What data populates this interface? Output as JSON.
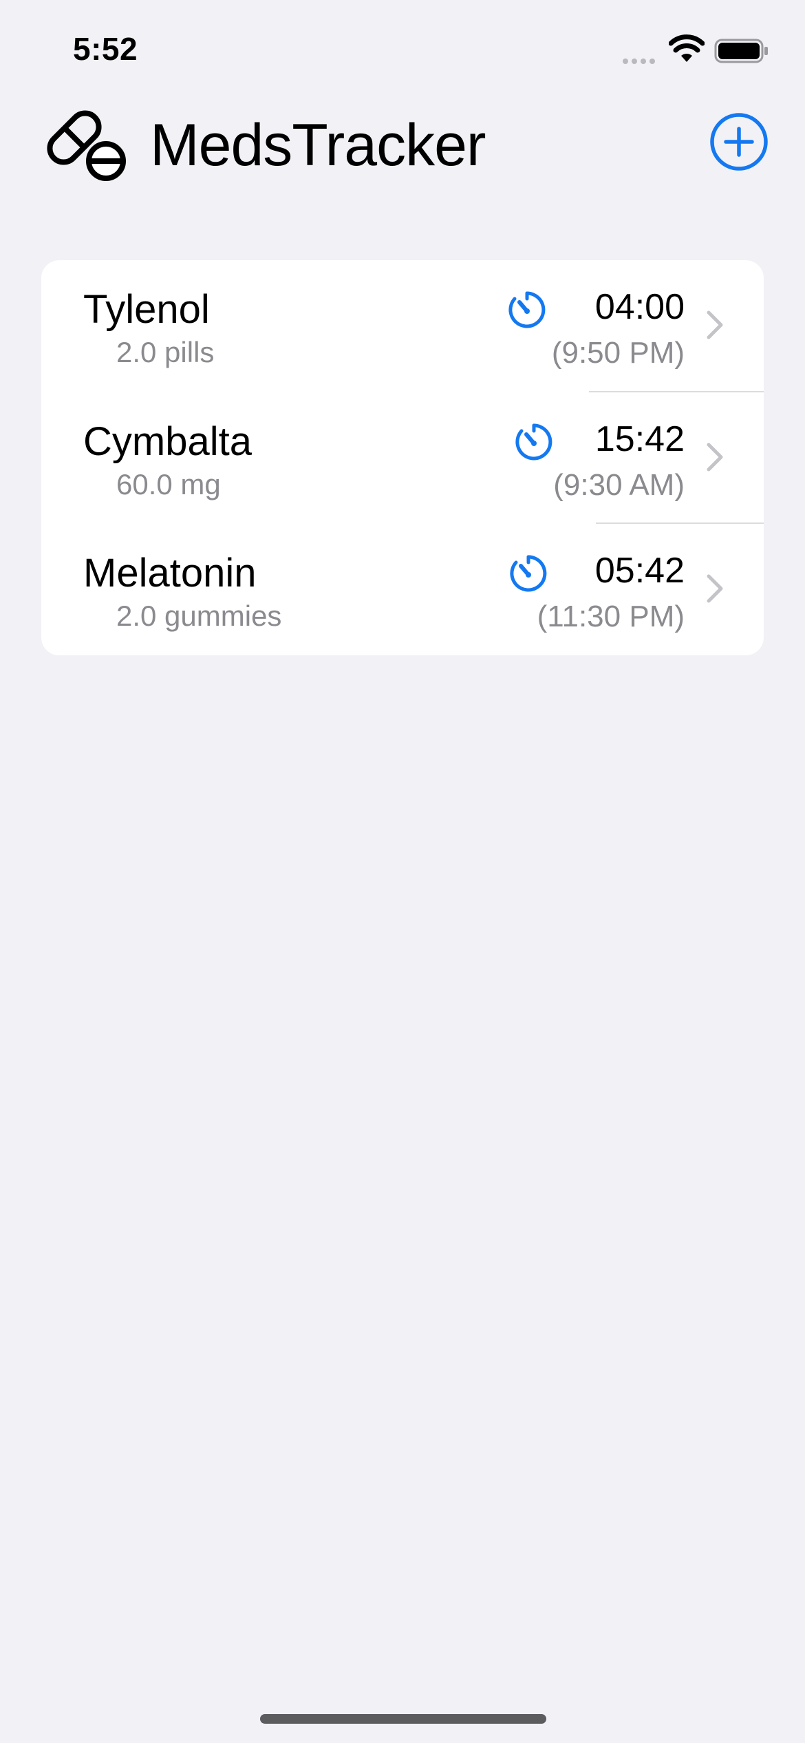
{
  "status_bar": {
    "time": "5:52",
    "signal_icon": "cellular-dots-icon",
    "wifi_icon": "wifi-icon",
    "battery_icon": "battery-icon"
  },
  "header": {
    "title": "MedsTracker",
    "logo_icon": "pills-icon",
    "add_icon": "plus-circle-icon"
  },
  "colors": {
    "accent": "#1479f0",
    "background": "#f1f1f6",
    "card": "#ffffff",
    "secondary_text": "#8a8a8f"
  },
  "medications": [
    {
      "name": "Tylenol",
      "dose": "2.0 pills",
      "countdown": "04:00",
      "time": "(9:50 PM)",
      "icon": "timer-icon"
    },
    {
      "name": "Cymbalta",
      "dose": "60.0 mg",
      "countdown": "15:42",
      "time": "(9:30 AM)",
      "icon": "timer-icon"
    },
    {
      "name": "Melatonin",
      "dose": "2.0 gummies",
      "countdown": "05:42",
      "time": "(11:30 PM)",
      "icon": "timer-icon"
    }
  ]
}
